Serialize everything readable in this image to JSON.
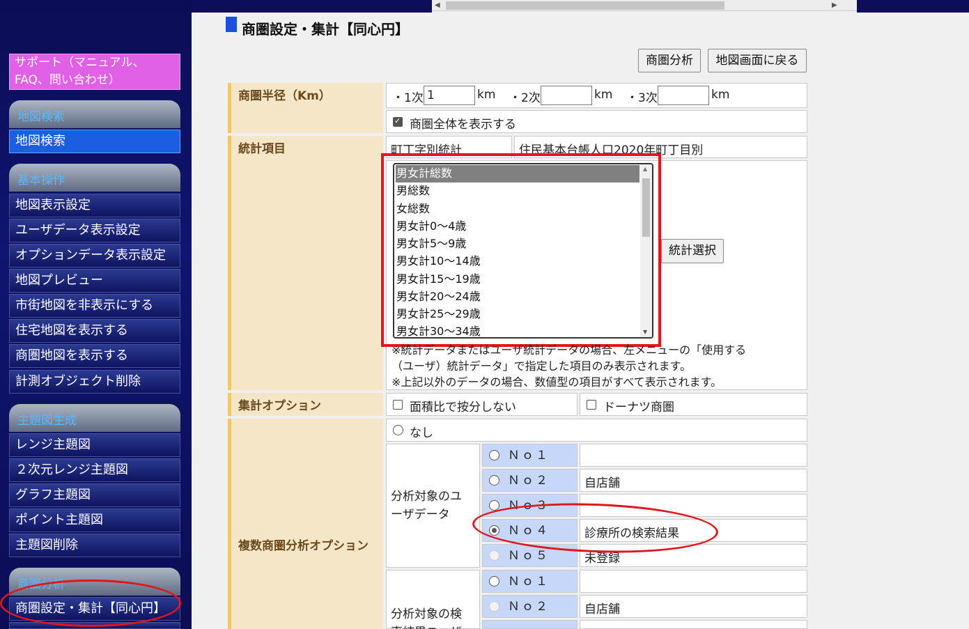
{
  "sidebar": {
    "support": "サポート（マニュアル、FAQ、問い合わせ）",
    "sections": [
      {
        "title": "地図検索",
        "items": [
          "地図検索"
        ]
      },
      {
        "title": "基本操作",
        "items": [
          "地図表示設定",
          "ユーザデータ表示設定",
          "オプションデータ表示設定",
          "地図プレビュー",
          "市街地図を非表示にする",
          "住宅地図を表示する",
          "商圏地図を表示する",
          "計測オブジェクト削除"
        ]
      },
      {
        "title": "主題図生成",
        "items": [
          "レンジ主題図",
          "２次元レンジ主題図",
          "グラフ主題図",
          "ポイント主題図",
          "主題図削除"
        ]
      },
      {
        "title": "商圏分析",
        "items": [
          "商圏設定・集計【同心円】"
        ]
      }
    ]
  },
  "main": {
    "title": "商圏設定・集計【同心円】",
    "buttons": {
      "analysis": "商圏分析",
      "back": "地図画面に戻る",
      "select_stat": "統計選択"
    },
    "radius": {
      "label": "商圏半径（Km）",
      "r1_label": "・1次",
      "r1_value": "1",
      "r2_label": "・2次",
      "r2_value": "",
      "r3_label": "・3次",
      "r3_value": "",
      "unit": "km",
      "show_all": "商圏全体を表示する"
    },
    "stats": {
      "label": "統計項目",
      "category": "町丁字別統計",
      "dataset": "住民基本台帳人口2020年町丁目別",
      "options": [
        "男女計総数",
        "男総数",
        "女総数",
        "男女計0～4歳",
        "男女計5～9歳",
        "男女計10～14歳",
        "男女計15～19歳",
        "男女計20～24歳",
        "男女計25～29歳",
        "男女計30～34歳"
      ],
      "selected": "男女計総数",
      "note1": "※統計データまたはユーザ統計データの場合、左メニューの「使用する",
      "note2": "（ユーザ）統計データ」で指定した項目のみ表示されます。",
      "note3": "※上記以外のデータの場合、数値型の項目がすべて表示されます。"
    },
    "agg_options": {
      "label": "集計オプション",
      "no_area_ratio": "面積比で按分しない",
      "donut": "ドーナツ商圏"
    },
    "multi": {
      "label": "複数商圏分析オプション",
      "none": "なし",
      "user_data_label": "分析対象のユーザデータ",
      "user_rows": [
        {
          "no": "Ｎｏ１",
          "value": ""
        },
        {
          "no": "Ｎｏ２",
          "value": "自店舗"
        },
        {
          "no": "Ｎｏ３",
          "value": ""
        },
        {
          "no": "Ｎｏ４",
          "value": "診療所の検索結果"
        },
        {
          "no": "Ｎｏ５",
          "value": "未登録"
        }
      ],
      "search_label": "分析対象の検索結果ユーザ",
      "search_rows": [
        {
          "no": "Ｎｏ１",
          "value": ""
        },
        {
          "no": "Ｎｏ２",
          "value": "自店舗"
        }
      ]
    }
  },
  "colors": {
    "accent_red": "#e8141c",
    "sidebar_bg": "#0c0d55",
    "selected_blue": "#1c5ee0",
    "label_bg": "#f4e6c6",
    "support_pink": "#e060e6"
  }
}
